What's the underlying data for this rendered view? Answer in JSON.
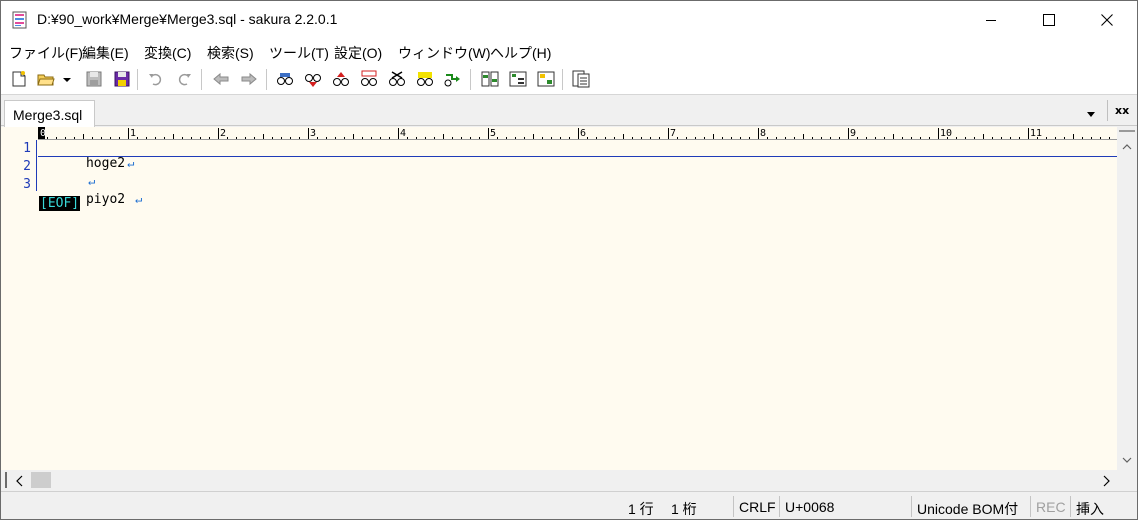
{
  "window": {
    "title": "D:¥90_work¥Merge¥Merge3.sql - sakura 2.2.0.1"
  },
  "menu": [
    {
      "label": "ファイル(F)"
    },
    {
      "label": "編集(E)"
    },
    {
      "label": "変換(C)"
    },
    {
      "label": "検索(S)"
    },
    {
      "label": "ツール(T)"
    },
    {
      "label": "設定(O)"
    },
    {
      "label": "ウィンドウ(W)"
    },
    {
      "label": "ヘルプ(H)"
    }
  ],
  "toolbar": {
    "icons": [
      "new-file-icon",
      "open-folder-icon",
      "dropdown-arrow-icon",
      "save-icon",
      "save-all-icon",
      "undo-icon",
      "redo-icon",
      "jump-back-icon",
      "jump-forward-icon",
      "search-icon",
      "search-next-icon",
      "search-prev-icon",
      "replace-icon",
      "clear-mark-icon",
      "grep-icon",
      "tag-jump-icon",
      "compare-icon",
      "outline-icon",
      "function-list-icon",
      "settings-list-icon"
    ]
  },
  "tabs": [
    {
      "label": "Merge3.sql",
      "active": true
    }
  ],
  "tabbar": {
    "close_all_label": "xx"
  },
  "ruler": {
    "labels": [
      "0",
      "1",
      "2",
      "3",
      "4",
      "5",
      "6",
      "7",
      "8",
      "9",
      "10",
      "11"
    ]
  },
  "editor": {
    "lines": [
      {
        "number": "1",
        "text": "hoge2",
        "eol": "↵"
      },
      {
        "number": "2",
        "text": "",
        "eol": "↵"
      },
      {
        "number": "3",
        "text": "piyo2 ",
        "eol": "↵"
      }
    ],
    "eof": "[EOF]"
  },
  "status": {
    "row": "1 行",
    "col": "1 桁",
    "eol_type": "CRLF",
    "codepoint": "U+0068",
    "encoding": "Unicode BOM付",
    "rec": "REC",
    "mode": "挿入"
  },
  "colors": {
    "editor_background": "#fffbf0",
    "line_number": "#1f3bb8",
    "eof_text": "#39d9d9",
    "eol_mark": "#1f6fd1"
  }
}
